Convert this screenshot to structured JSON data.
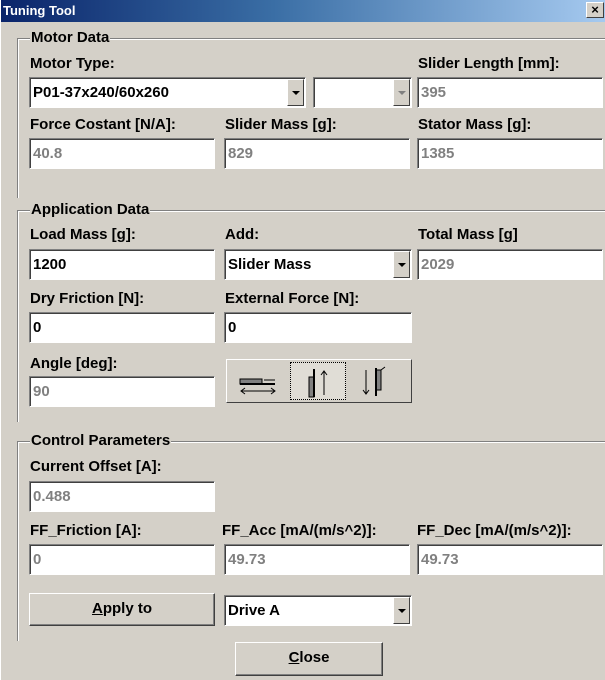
{
  "window": {
    "title": "Tuning Tool",
    "close_glyph": "×"
  },
  "motor": {
    "group_title": "Motor Data",
    "type_label": "Motor Type:",
    "type_value": "P01-37x240/60x260",
    "second_combo_value": "",
    "slider_length_label": "Slider Length [mm]:",
    "slider_length": "395",
    "force_constant_label": "Force Costant [N/A]:",
    "force_constant": "40.8",
    "slider_mass_label": "Slider Mass [g]:",
    "slider_mass": "829",
    "stator_mass_label": "Stator Mass [g]:",
    "stator_mass": "1385"
  },
  "application": {
    "group_title": "Application Data",
    "load_mass_label": "Load Mass [g]:",
    "load_mass": "1200",
    "add_label": "Add:",
    "add_value": "Slider Mass",
    "total_mass_label": "Total Mass [g]",
    "total_mass": "2029",
    "dry_friction_label": "Dry Friction [N]:",
    "dry_friction": "0",
    "external_force_label": "External Force [N]:",
    "external_force": "0",
    "angle_label": "Angle [deg]:",
    "angle": "90",
    "orientation": {
      "options": [
        "horizontal-orientation-icon",
        "vertical-up-orientation-icon",
        "vertical-down-orientation-icon"
      ],
      "selected": "vertical-up-orientation-icon"
    }
  },
  "control": {
    "group_title": "Control Parameters",
    "current_offset_label": "Current Offset [A]:",
    "current_offset": "0.488",
    "ff_friction_label": "FF_Friction [A]:",
    "ff_friction": "0",
    "ff_acc_label": "FF_Acc [mA/(m/s^2)]:",
    "ff_acc": "49.73",
    "ff_dec_label": "FF_Dec [mA/(m/s^2)]:",
    "ff_dec": "49.73",
    "apply_mnemonic": "A",
    "apply_rest": "pply to",
    "drive_value": "Drive A"
  },
  "footer": {
    "close_mnemonic": "C",
    "close_rest": "lose"
  },
  "colors": {
    "dialog_bg": "#d4d0c8",
    "title_bar_start": "#0a246a",
    "title_bar_end": "#a6caf0",
    "disabled_text": "#808080"
  }
}
